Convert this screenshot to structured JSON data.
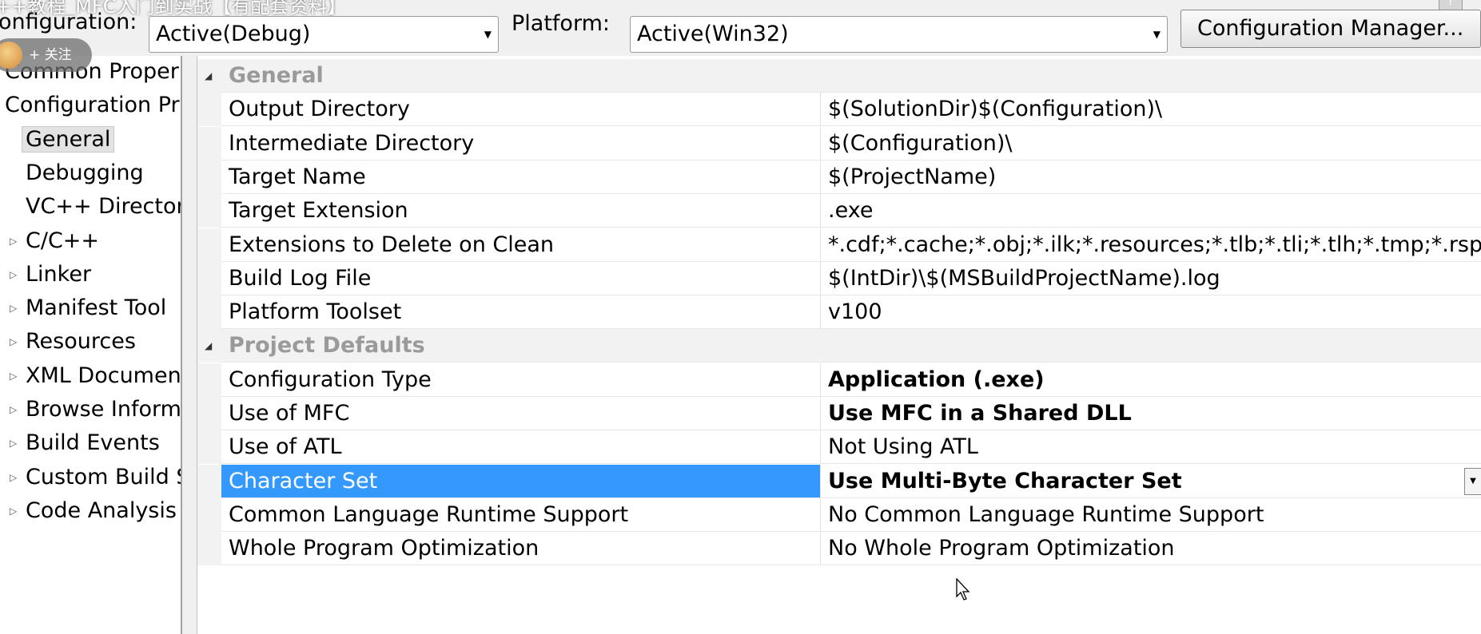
{
  "title_overlay": "++教程_MFC入门到实战【有配套资料】",
  "toolbar": {
    "configuration_label": "onfiguration:",
    "configuration_value": "Active(Debug)",
    "platform_label": "Platform:",
    "platform_value": "Active(Win32)",
    "config_manager_button": "Configuration Manager...",
    "help_label": "?"
  },
  "follow_badge": "+ 关注",
  "sidebar": {
    "items": [
      {
        "label": "Common Proper",
        "expander": "",
        "selected": false
      },
      {
        "label": "Configuration Pr",
        "expander": "",
        "selected": false
      },
      {
        "label": "General",
        "expander": "",
        "selected": true
      },
      {
        "label": "Debugging",
        "expander": "",
        "selected": false
      },
      {
        "label": "VC++ Director",
        "expander": "",
        "selected": false
      },
      {
        "label": "C/C++",
        "expander": "▷",
        "selected": false
      },
      {
        "label": "Linker",
        "expander": "▷",
        "selected": false
      },
      {
        "label": "Manifest Tool",
        "expander": "▷",
        "selected": false
      },
      {
        "label": "Resources",
        "expander": "▷",
        "selected": false
      },
      {
        "label": "XML Documen",
        "expander": "▷",
        "selected": false
      },
      {
        "label": "Browse Inform",
        "expander": "▷",
        "selected": false
      },
      {
        "label": "Build Events",
        "expander": "▷",
        "selected": false
      },
      {
        "label": "Custom Build S",
        "expander": "▷",
        "selected": false
      },
      {
        "label": "Code Analysis",
        "expander": "▷",
        "selected": false
      }
    ]
  },
  "grid": {
    "rows": [
      {
        "type": "category",
        "name": "General"
      },
      {
        "type": "prop",
        "name": "Output Directory",
        "value": "$(SolutionDir)$(Configuration)\\",
        "bold": false
      },
      {
        "type": "prop",
        "name": "Intermediate Directory",
        "value": "$(Configuration)\\",
        "bold": false
      },
      {
        "type": "prop",
        "name": "Target Name",
        "value": "$(ProjectName)",
        "bold": false
      },
      {
        "type": "prop",
        "name": "Target Extension",
        "value": ".exe",
        "bold": false
      },
      {
        "type": "prop",
        "name": "Extensions to Delete on Clean",
        "value": "*.cdf;*.cache;*.obj;*.ilk;*.resources;*.tlb;*.tli;*.tlh;*.tmp;*.rsp;*.pg",
        "bold": false
      },
      {
        "type": "prop",
        "name": "Build Log File",
        "value": "$(IntDir)\\$(MSBuildProjectName).log",
        "bold": false
      },
      {
        "type": "prop",
        "name": "Platform Toolset",
        "value": "v100",
        "bold": false
      },
      {
        "type": "category",
        "name": "Project Defaults"
      },
      {
        "type": "prop",
        "name": "Configuration Type",
        "value": "Application (.exe)",
        "bold": true
      },
      {
        "type": "prop",
        "name": "Use of MFC",
        "value": "Use MFC in a Shared DLL",
        "bold": true
      },
      {
        "type": "prop",
        "name": "Use of ATL",
        "value": "Not Using ATL",
        "bold": false
      },
      {
        "type": "prop",
        "name": "Character Set",
        "value": "Use Multi-Byte Character Set",
        "bold": true,
        "selected": true
      },
      {
        "type": "prop",
        "name": "Common Language Runtime Support",
        "value": "No Common Language Runtime Support",
        "bold": false
      },
      {
        "type": "prop",
        "name": "Whole Program Optimization",
        "value": "No Whole Program Optimization",
        "bold": false
      }
    ]
  },
  "colors": {
    "selection": "#3399ff",
    "category_text": "#9a9a9a"
  }
}
